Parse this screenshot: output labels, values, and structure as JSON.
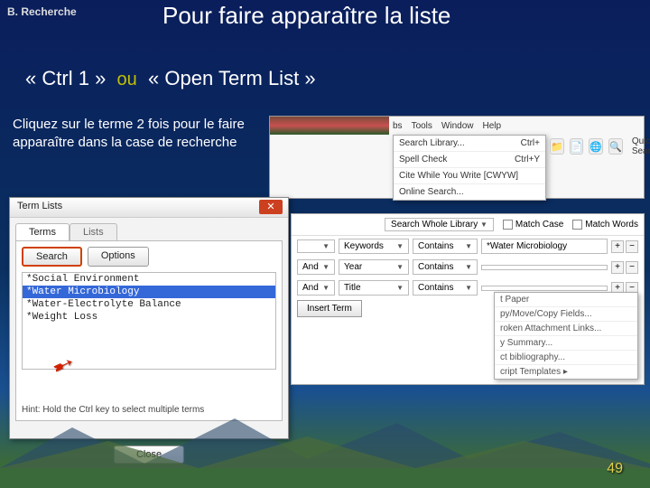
{
  "crumb": "B.  Recherche",
  "title": "Pour faire apparaître la liste",
  "shortcut": {
    "open": "«",
    "close": "»",
    "key": "Ctrl 1",
    "ou": "ou",
    "alt": "Open Term List"
  },
  "instruction": "Cliquez sur le terme 2 fois pour le faire apparaître dans la case de recherche",
  "pagenum": "49",
  "toolbar": {
    "menus": [
      "bs",
      "Tools",
      "Window",
      "Help"
    ],
    "dropdown": [
      {
        "l": "Search Library...",
        "r": "Ctrl+"
      },
      {
        "l": "Spell Check",
        "r": "Ctrl+Y"
      },
      {
        "l": "Cite While You Write [CWYW]",
        "r": ""
      },
      {
        "l": "Online Search...",
        "r": ""
      }
    ],
    "quicksearch": "Quick Sear"
  },
  "termlist": {
    "title": "Term Lists",
    "tabs": [
      "Terms",
      "Lists"
    ],
    "buttons": {
      "search": "Search",
      "options": "Options"
    },
    "items": [
      "*Social Environment",
      "*Water Microbiology",
      "*Water-Electrolyte Balance",
      "*Weight Loss"
    ],
    "selectedIndex": 1,
    "hint": "Hint: Hold the Ctrl key to select multiple terms",
    "close": "Close"
  },
  "search": {
    "scope": "Search Whole Library",
    "matchcase": "Match Case",
    "matchwords": "Match Words",
    "rows": [
      {
        "op": "",
        "field": "Keywords",
        "cond": "Contains",
        "val": "*Water Microbiology"
      },
      {
        "op": "And",
        "field": "Year",
        "cond": "Contains",
        "val": ""
      },
      {
        "op": "And",
        "field": "Title",
        "cond": "Contains",
        "val": ""
      }
    ],
    "insert": "Insert Term",
    "rmenu": [
      "t Paper",
      "py/Move/Copy Fields...",
      "",
      "roken Attachment Links...",
      "y Summary...",
      "ct bibliography...",
      "cript Templates   ▸"
    ]
  }
}
